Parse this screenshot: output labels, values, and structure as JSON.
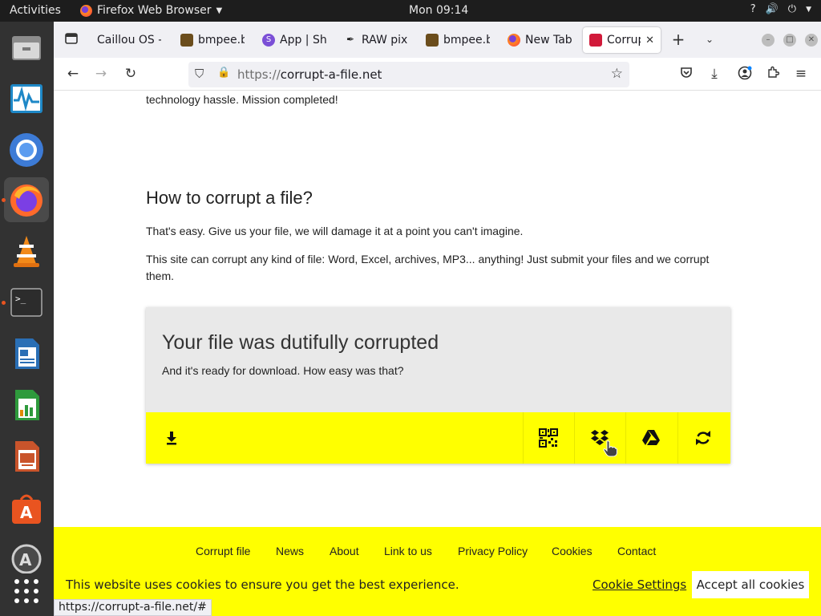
{
  "topbar": {
    "activities": "Activities",
    "app_name": "Firefox Web Browser",
    "clock": "Mon 09:14"
  },
  "dock": {
    "apps": [
      "files",
      "system-monitor",
      "chromium",
      "firefox",
      "vlc",
      "terminal",
      "writer",
      "calc",
      "impress",
      "software-center",
      "help",
      "app-grid"
    ]
  },
  "tabs": [
    {
      "label": "Caillou OS -",
      "favicon": "none"
    },
    {
      "label": "bmpee.b",
      "favicon": "folder"
    },
    {
      "label": "App | Sh",
      "favicon": "s-purple"
    },
    {
      "label": "RAW pix",
      "favicon": "pen"
    },
    {
      "label": "bmpee.b",
      "favicon": "folder"
    },
    {
      "label": "New Tab",
      "favicon": "firefox"
    },
    {
      "label": "Corrup",
      "favicon": "corrupt",
      "active": true
    }
  ],
  "navbar": {
    "url_scheme": "https://",
    "url_host": "corrupt-a-file.net"
  },
  "page": {
    "intro_tail": "technology hassle. Mission completed!",
    "heading": "How to corrupt a file?",
    "para1": "That's easy. Give us your file, we will damage it at a point you can't imagine.",
    "para2": "This site can corrupt any kind of file: Word, Excel, archives, MP3... anything! Just submit your files and we corrupt them.",
    "card": {
      "title": "Your file was dutifully corrupted",
      "subtitle": "And it's ready for download. How easy was that?",
      "actions": [
        "download-icon",
        "qr-code-icon",
        "dropbox-icon",
        "google-drive-icon",
        "refresh-icon"
      ]
    },
    "footer_links": [
      "Corrupt file",
      "News",
      "About",
      "Link to us",
      "Privacy Policy",
      "Cookies",
      "Contact"
    ]
  },
  "cookie": {
    "message": "This website uses cookies to ensure you get the best experience.",
    "settings": "Cookie Settings",
    "accept": "Accept all cookies"
  },
  "status_url": "https://corrupt-a-file.net/#",
  "colors": {
    "accent_yellow": "#ffff00",
    "ubuntu_orange": "#e95420"
  }
}
